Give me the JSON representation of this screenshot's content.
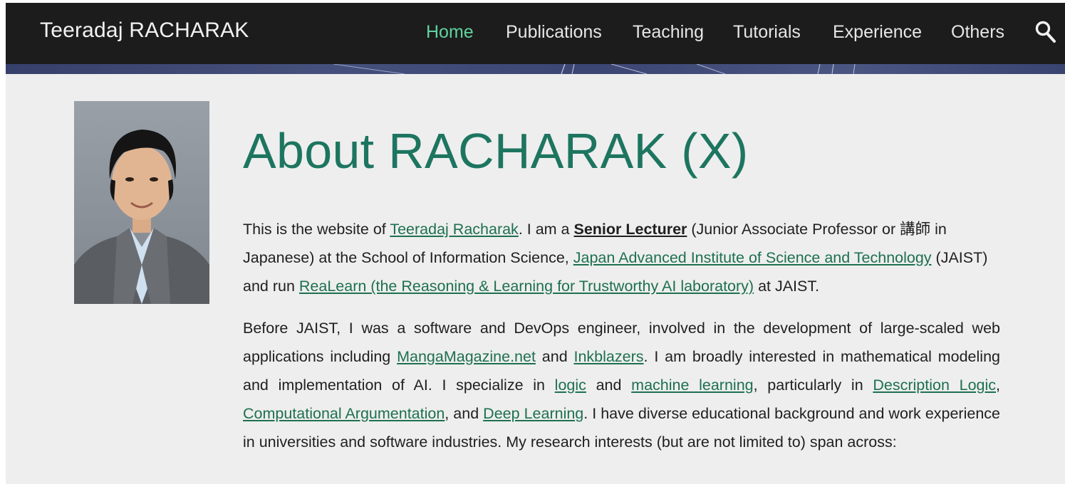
{
  "site": {
    "brand": "Teeradaj RACHARAK"
  },
  "nav": {
    "items": [
      {
        "label": "Home",
        "active": true
      },
      {
        "label": "Publications",
        "active": false
      },
      {
        "label": "Teaching",
        "active": false
      },
      {
        "label": "Tutorials",
        "active": false
      },
      {
        "label": "Experience",
        "active": false
      },
      {
        "label": "Others",
        "active": false
      }
    ],
    "search_icon": "search-icon"
  },
  "colors": {
    "navbar_bg": "#1c1c1c",
    "active_link": "#5fd3a0",
    "accent": "#1d7560",
    "link": "#1d7050",
    "page_bg": "#eeeeee"
  },
  "main": {
    "title": "About RACHARAK (X)",
    "p1": {
      "t1": "This is the website of ",
      "link_name": "Teeradaj Racharak",
      "t2": ". I am a ",
      "role": "Senior Lecturer",
      "t3": " (Junior Associate Professor or 講師 in Japanese) at the School of Information Science, ",
      "link_jaist": "Japan Advanced Institute of Science and Technology",
      "t4": " (JAIST) and run ",
      "link_lab": "ReaLearn (the Reasoning & Learning for Trustworthy AI laboratory)",
      "t5": " at JAIST."
    },
    "p2": {
      "t1": "Before JAIST, I was a software and DevOps engineer, involved in the development of large-scaled web applications including ",
      "link_manga": "MangaMagazine.net",
      "t2": " and ",
      "link_ink": "Inkblazers",
      "t3": ". I am broadly interested in mathematical modeling and implementation of AI. I specialize in ",
      "link_logic": "logic",
      "t4": " and ",
      "link_ml": "machine learning",
      "t5": ", particularly in ",
      "link_dl": "Description Logic",
      "t6": ", ",
      "link_ca": "Computational Argumentation",
      "t7": ", and ",
      "link_deep": "Deep Learning",
      "t8": ". I have diverse educational background and work experience in universities and software industries. My research interests (but are not limited to) span across:"
    }
  }
}
